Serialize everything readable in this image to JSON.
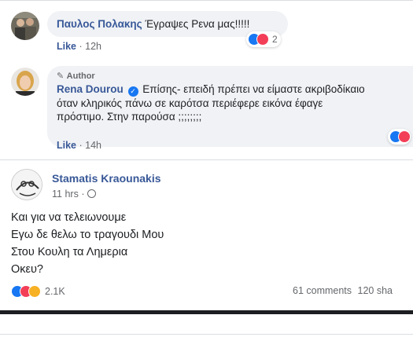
{
  "comments": [
    {
      "author": "Παυλος Πολακης",
      "text": "Έγραψες Ρενα μας!!!!!",
      "like_label": "Like",
      "time": "12h",
      "reaction_count": "2"
    },
    {
      "badge": "Author",
      "author": "Rena Dourou",
      "text_lines": [
        "Επίσης- επειδή πρέπει να είμαστε ακριβοδίκαιο",
        "όταν κληρικός πάνω σε καρότσα περιέφερε εικόνα έφαγε",
        "πρόστιμο. Στην παρούσα ;;;;;;;;"
      ],
      "like_label": "Like",
      "time": "14h"
    }
  ],
  "post": {
    "author": "Stamatis Kraounakis",
    "time": "11 hrs",
    "lines": [
      "Και για να τελειωνουμε",
      "Εγω δε θελω το τραγουδι Μου",
      "Στου Κουλη τα Λημερια",
      "Οκευ?"
    ],
    "reaction_count": "2.1K",
    "comments_count": "61 comments",
    "shares_count": "120 sha"
  },
  "colors": {
    "link": "#385898",
    "bubble": "#f0f2f5",
    "like": "#1877f2",
    "love": "#f33e58",
    "haha": "#f7b125"
  }
}
